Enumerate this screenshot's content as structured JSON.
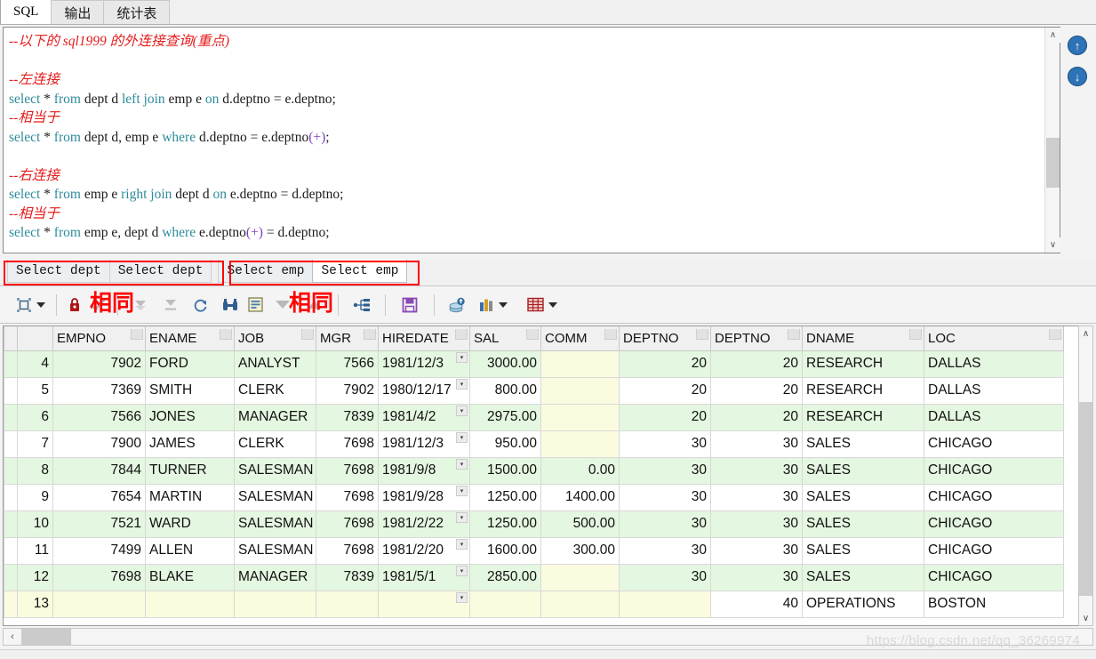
{
  "top_tabs": [
    {
      "label": "SQL",
      "active": true
    },
    {
      "label": "输出",
      "active": false
    },
    {
      "label": "统计表",
      "active": false
    }
  ],
  "editor": {
    "lines": [
      [
        {
          "t": "--以下的 sql1999 的外连接查询(重点)",
          "c": "cm"
        }
      ],
      [
        {
          "t": "",
          "c": "op"
        }
      ],
      [
        {
          "t": "--左连接",
          "c": "cm"
        }
      ],
      [
        {
          "t": "select",
          "c": "kw"
        },
        {
          "t": " * ",
          "c": "op"
        },
        {
          "t": "from",
          "c": "kw"
        },
        {
          "t": " dept d ",
          "c": "op"
        },
        {
          "t": "left",
          "c": "kw"
        },
        {
          "t": " ",
          "c": "op"
        },
        {
          "t": "join",
          "c": "kw"
        },
        {
          "t": " emp e ",
          "c": "op"
        },
        {
          "t": "on",
          "c": "kw"
        },
        {
          "t": " d.deptno = e.deptno;",
          "c": "op"
        }
      ],
      [
        {
          "t": "--相当于",
          "c": "cm"
        }
      ],
      [
        {
          "t": "select",
          "c": "kw"
        },
        {
          "t": " * ",
          "c": "op"
        },
        {
          "t": "from",
          "c": "kw"
        },
        {
          "t": " dept d, emp e ",
          "c": "op"
        },
        {
          "t": "where",
          "c": "kw"
        },
        {
          "t": " d.deptno = e.deptno",
          "c": "op"
        },
        {
          "t": "(+)",
          "c": "pl"
        },
        {
          "t": ";",
          "c": "op"
        }
      ],
      [
        {
          "t": "",
          "c": "op"
        }
      ],
      [
        {
          "t": "--右连接",
          "c": "cm"
        }
      ],
      [
        {
          "t": "select",
          "c": "kw"
        },
        {
          "t": " * ",
          "c": "op"
        },
        {
          "t": "from",
          "c": "kw"
        },
        {
          "t": " emp e ",
          "c": "op"
        },
        {
          "t": "right",
          "c": "kw"
        },
        {
          "t": " ",
          "c": "op"
        },
        {
          "t": "join",
          "c": "kw"
        },
        {
          "t": " dept d ",
          "c": "op"
        },
        {
          "t": "on",
          "c": "kw"
        },
        {
          "t": " e.deptno = d.deptno;",
          "c": "op"
        }
      ],
      [
        {
          "t": "--相当于",
          "c": "cm"
        }
      ],
      [
        {
          "t": "select",
          "c": "kw"
        },
        {
          "t": " * ",
          "c": "op"
        },
        {
          "t": "from",
          "c": "kw"
        },
        {
          "t": " emp e, dept d ",
          "c": "op"
        },
        {
          "t": "where",
          "c": "kw"
        },
        {
          "t": " e.deptno",
          "c": "op"
        },
        {
          "t": "(+)",
          "c": "pl"
        },
        {
          "t": " = d.deptno;",
          "c": "op"
        }
      ]
    ]
  },
  "side_buttons": [
    {
      "name": "scroll-up",
      "glyph": "↑"
    },
    {
      "name": "scroll-down",
      "glyph": "↓"
    }
  ],
  "result_tabs": [
    {
      "label": "Select dept",
      "selected": false
    },
    {
      "label": "Select dept",
      "selected": false
    },
    {
      "label": "Select emp",
      "selected": false
    },
    {
      "label": "Select emp",
      "selected": true
    }
  ],
  "annotations": [
    {
      "text": "相同",
      "color": "#ff0000"
    },
    {
      "text": "相同",
      "color": "#ff0000"
    }
  ],
  "toolbar": {
    "items": [
      {
        "name": "layout-icon",
        "glyph": "⬚",
        "dropdown": true
      },
      {
        "name": "lock-icon",
        "glyph": "🔒"
      },
      {
        "name": "commit-check-icon",
        "glyph": "✔"
      },
      {
        "name": "fetch-next-icon",
        "glyph": "▼"
      },
      {
        "name": "fetch-all-icon",
        "glyph": "▼"
      },
      {
        "name": "refresh-icon",
        "glyph": "⟳"
      },
      {
        "name": "find-icon",
        "glyph": "🔍"
      },
      {
        "name": "single-record-icon",
        "glyph": "▤"
      },
      {
        "name": "sort-desc-icon",
        "glyph": "▽"
      },
      {
        "name": "sort-asc-icon",
        "glyph": "△"
      },
      {
        "name": "filter-tree-icon",
        "glyph": "⛓"
      },
      {
        "name": "save-icon",
        "glyph": "💾"
      },
      {
        "name": "export-icon",
        "glyph": "⬆"
      },
      {
        "name": "chart-icon",
        "glyph": "📊",
        "dropdown": true
      },
      {
        "name": "grid-icon",
        "glyph": "▦",
        "dropdown": true
      }
    ]
  },
  "grid": {
    "columns": [
      "EMPNO",
      "ENAME",
      "JOB",
      "MGR",
      "HIREDATE",
      "SAL",
      "COMM",
      "DEPTNO",
      "DEPTNO",
      "DNAME",
      "LOC"
    ],
    "rows": [
      {
        "n": "4",
        "cells": [
          "7902",
          "FORD",
          "ANALYST",
          "7566",
          "1981/12/3",
          "3000.00",
          "",
          "20",
          "20",
          "RESEARCH",
          "DALLAS"
        ]
      },
      {
        "n": "5",
        "cells": [
          "7369",
          "SMITH",
          "CLERK",
          "7902",
          "1980/12/17",
          "800.00",
          "",
          "20",
          "20",
          "RESEARCH",
          "DALLAS"
        ]
      },
      {
        "n": "6",
        "cells": [
          "7566",
          "JONES",
          "MANAGER",
          "7839",
          "1981/4/2",
          "2975.00",
          "",
          "20",
          "20",
          "RESEARCH",
          "DALLAS"
        ]
      },
      {
        "n": "7",
        "cells": [
          "7900",
          "JAMES",
          "CLERK",
          "7698",
          "1981/12/3",
          "950.00",
          "",
          "30",
          "30",
          "SALES",
          "CHICAGO"
        ]
      },
      {
        "n": "8",
        "cells": [
          "7844",
          "TURNER",
          "SALESMAN",
          "7698",
          "1981/9/8",
          "1500.00",
          "0.00",
          "30",
          "30",
          "SALES",
          "CHICAGO"
        ]
      },
      {
        "n": "9",
        "cells": [
          "7654",
          "MARTIN",
          "SALESMAN",
          "7698",
          "1981/9/28",
          "1250.00",
          "1400.00",
          "30",
          "30",
          "SALES",
          "CHICAGO"
        ]
      },
      {
        "n": "10",
        "cells": [
          "7521",
          "WARD",
          "SALESMAN",
          "7698",
          "1981/2/22",
          "1250.00",
          "500.00",
          "30",
          "30",
          "SALES",
          "CHICAGO"
        ]
      },
      {
        "n": "11",
        "cells": [
          "7499",
          "ALLEN",
          "SALESMAN",
          "7698",
          "1981/2/20",
          "1600.00",
          "300.00",
          "30",
          "30",
          "SALES",
          "CHICAGO"
        ]
      },
      {
        "n": "12",
        "cells": [
          "7698",
          "BLAKE",
          "MANAGER",
          "7839",
          "1981/5/1",
          "2850.00",
          "",
          "30",
          "30",
          "SALES",
          "CHICAGO"
        ]
      },
      {
        "n": "13",
        "cells": [
          "",
          "",
          "",
          "",
          "",
          "",
          "",
          "",
          "40",
          "OPERATIONS",
          "BOSTON"
        ]
      }
    ]
  },
  "scrollbars": {
    "grid_h_left_glyph": "‹",
    "up_glyph": "∧",
    "down_glyph": "∨"
  },
  "watermark": "https://blog.csdn.net/qq_36269974"
}
